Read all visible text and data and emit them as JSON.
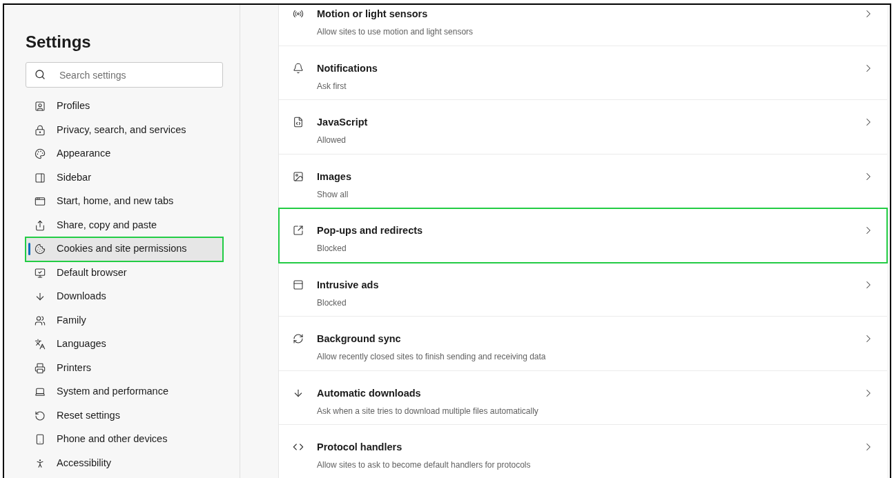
{
  "sidebar": {
    "title": "Settings",
    "search": {
      "placeholder": "Search settings"
    },
    "items": [
      {
        "label": "Profiles",
        "selected": false,
        "highlighted": false
      },
      {
        "label": "Privacy, search, and services",
        "selected": false,
        "highlighted": false
      },
      {
        "label": "Appearance",
        "selected": false,
        "highlighted": false
      },
      {
        "label": "Sidebar",
        "selected": false,
        "highlighted": false
      },
      {
        "label": "Start, home, and new tabs",
        "selected": false,
        "highlighted": false
      },
      {
        "label": "Share, copy and paste",
        "selected": false,
        "highlighted": false
      },
      {
        "label": "Cookies and site permissions",
        "selected": true,
        "highlighted": true
      },
      {
        "label": "Default browser",
        "selected": false,
        "highlighted": false
      },
      {
        "label": "Downloads",
        "selected": false,
        "highlighted": false
      },
      {
        "label": "Family",
        "selected": false,
        "highlighted": false
      },
      {
        "label": "Languages",
        "selected": false,
        "highlighted": false
      },
      {
        "label": "Printers",
        "selected": false,
        "highlighted": false
      },
      {
        "label": "System and performance",
        "selected": false,
        "highlighted": false
      },
      {
        "label": "Reset settings",
        "selected": false,
        "highlighted": false
      },
      {
        "label": "Phone and other devices",
        "selected": false,
        "highlighted": false
      },
      {
        "label": "Accessibility",
        "selected": false,
        "highlighted": false
      }
    ]
  },
  "permissions": [
    {
      "title": "Motion or light sensors",
      "subtitle": "Allow sites to use motion and light sensors",
      "highlighted": false
    },
    {
      "title": "Notifications",
      "subtitle": "Ask first",
      "highlighted": false
    },
    {
      "title": "JavaScript",
      "subtitle": "Allowed",
      "highlighted": false
    },
    {
      "title": "Images",
      "subtitle": "Show all",
      "highlighted": false
    },
    {
      "title": "Pop-ups and redirects",
      "subtitle": "Blocked",
      "highlighted": true
    },
    {
      "title": "Intrusive ads",
      "subtitle": "Blocked",
      "highlighted": false
    },
    {
      "title": "Background sync",
      "subtitle": "Allow recently closed sites to finish sending and receiving data",
      "highlighted": false
    },
    {
      "title": "Automatic downloads",
      "subtitle": "Ask when a site tries to download multiple files automatically",
      "highlighted": false
    },
    {
      "title": "Protocol handlers",
      "subtitle": "Allow sites to ask to become default handlers for protocols",
      "highlighted": false
    }
  ]
}
